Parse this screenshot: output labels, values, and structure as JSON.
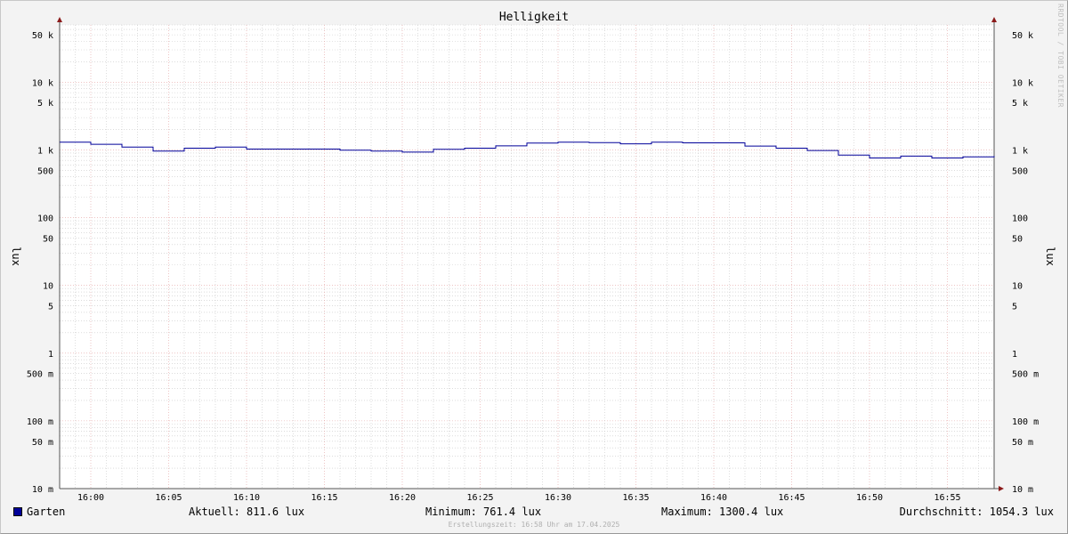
{
  "chart_data": {
    "type": "line",
    "title": "Helligkeit",
    "ylabel": "lux",
    "ylabel_right": "lux",
    "y_scale": "log",
    "ylim": [
      0.01,
      70000
    ],
    "xlim": [
      "15:58",
      "17:58"
    ],
    "x_ticks": [
      "16:00",
      "16:05",
      "16:10",
      "16:15",
      "16:20",
      "16:25",
      "16:30",
      "16:35",
      "16:40",
      "16:45",
      "16:50",
      "16:55"
    ],
    "y_ticks": [
      {
        "value": 50000,
        "label": "50 k"
      },
      {
        "value": 10000,
        "label": "10 k"
      },
      {
        "value": 5000,
        "label": "5 k"
      },
      {
        "value": 1000,
        "label": "1 k"
      },
      {
        "value": 500,
        "label": "500"
      },
      {
        "value": 100,
        "label": "100"
      },
      {
        "value": 50,
        "label": "50"
      },
      {
        "value": 10,
        "label": "10"
      },
      {
        "value": 5,
        "label": "5"
      },
      {
        "value": 1,
        "label": "1"
      },
      {
        "value": 0.5,
        "label": "500 m"
      },
      {
        "value": 0.1,
        "label": "100 m"
      },
      {
        "value": 0.05,
        "label": "50 m"
      },
      {
        "value": 0.01,
        "label": "10 m"
      }
    ],
    "grid": true,
    "legend_placement": "bottom",
    "series": [
      {
        "name": "Garten",
        "color": "#000099",
        "step": true,
        "points": [
          {
            "x": "15:58",
            "y": 1300
          },
          {
            "x": "16:00",
            "y": 1210
          },
          {
            "x": "16:02",
            "y": 1100
          },
          {
            "x": "16:04",
            "y": 960
          },
          {
            "x": "16:06",
            "y": 1060
          },
          {
            "x": "16:08",
            "y": 1100
          },
          {
            "x": "16:10",
            "y": 1030
          },
          {
            "x": "16:12",
            "y": 1030
          },
          {
            "x": "16:14",
            "y": 1030
          },
          {
            "x": "16:16",
            "y": 990
          },
          {
            "x": "16:18",
            "y": 960
          },
          {
            "x": "16:20",
            "y": 930
          },
          {
            "x": "16:22",
            "y": 1020
          },
          {
            "x": "16:24",
            "y": 1060
          },
          {
            "x": "16:26",
            "y": 1150
          },
          {
            "x": "16:28",
            "y": 1260
          },
          {
            "x": "16:30",
            "y": 1300
          },
          {
            "x": "16:32",
            "y": 1280
          },
          {
            "x": "16:34",
            "y": 1230
          },
          {
            "x": "16:36",
            "y": 1300
          },
          {
            "x": "16:38",
            "y": 1270
          },
          {
            "x": "16:40",
            "y": 1270
          },
          {
            "x": "16:42",
            "y": 1140
          },
          {
            "x": "16:44",
            "y": 1060
          },
          {
            "x": "16:46",
            "y": 980
          },
          {
            "x": "16:48",
            "y": 840
          },
          {
            "x": "16:50",
            "y": 761
          },
          {
            "x": "16:52",
            "y": 811
          },
          {
            "x": "16:54",
            "y": 761
          },
          {
            "x": "16:56",
            "y": 790
          },
          {
            "x": "16:58",
            "y": 811.6
          }
        ]
      }
    ]
  },
  "legend": {
    "series_name": "Garten",
    "current": "Aktuell: 811.6 lux",
    "minimum": "Minimum: 761.4 lux",
    "maximum": "Maximum: 1300.4 lux",
    "average": "Durchschnitt: 1054.3 lux"
  },
  "credit": "RRDTOOL / TOBI OETIKER",
  "footer": "Erstellungszeit: 16:58 Uhr am 17.04.2025",
  "colors": {
    "line": "#000099",
    "major_grid": "#e3a0a0",
    "minor_grid": "#c8c8c8",
    "axis": "#555555",
    "arrow": "#8b1a1a"
  }
}
